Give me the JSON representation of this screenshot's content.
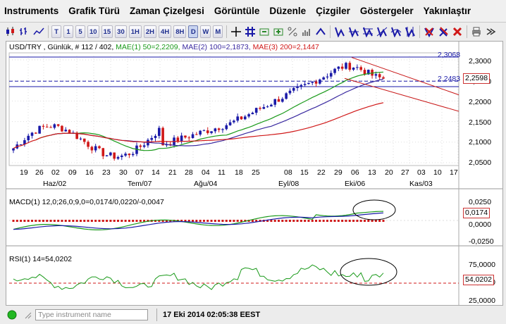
{
  "menu": [
    "Instruments",
    "Grafik Türü",
    "Zaman Çizelgesi",
    "Görüntüle",
    "Düzenle",
    "Çizgiler",
    "Göstergeler",
    "Yakınlaştır"
  ],
  "toolbar": {
    "timeframes": [
      "T",
      "1",
      "5",
      "10",
      "15",
      "30",
      "1H",
      "2H",
      "4H",
      "8H",
      "D",
      "W",
      "M"
    ],
    "selected": "D"
  },
  "chart": {
    "legend": {
      "symbol": "USD/TRY , Günlük, # 112 / 402,",
      "mae1": "MAE(1) 50=2,2209,",
      "mae2": "MAE(2) 100=2,1873,",
      "mae3": "MAE(3) 200=2,1447"
    },
    "price_axis": [
      "2,3000",
      "2,2500",
      "2,2000",
      "2,1500",
      "2,1000",
      "2,0500"
    ],
    "price_high": "2,3068",
    "price_mid": "2,2483",
    "price_last": "2,2598",
    "date_labels": [
      "19",
      "26",
      "02",
      "09",
      "16",
      "23",
      "30",
      "07",
      "14",
      "21",
      "28",
      "04",
      "11",
      "18",
      "25",
      "08",
      "15",
      "22",
      "29",
      "06",
      "13",
      "20",
      "27",
      "03",
      "10",
      "17"
    ],
    "month_labels": [
      "Haz/02",
      "Tem/07",
      "Ağu/04",
      "Eyl/08",
      "Eki/06",
      "Kas/03"
    ],
    "macd": {
      "title": "MACD(1) 12,0;26,0;9,0=0,0174/0,0220/-0,0047",
      "axis": [
        "0,0250",
        "0,0000",
        "-0,0250"
      ],
      "last": "0,0174"
    },
    "rsi": {
      "title": "RSI(1) 14=54,0202",
      "axis": [
        "75,0000",
        "50,0000",
        "25,0000"
      ],
      "last": "54,0202"
    },
    "colors": {
      "mae1": "#1a9a1a",
      "mae2": "#3a2aa0",
      "mae3": "#d01818",
      "bull": "#1a1aa8",
      "bear": "#d01818",
      "trend": "#c81818"
    }
  },
  "status": {
    "search_placeholder": "Type instrument name",
    "datetime": "17 Eki 2014 02:05:38 EEST"
  }
}
